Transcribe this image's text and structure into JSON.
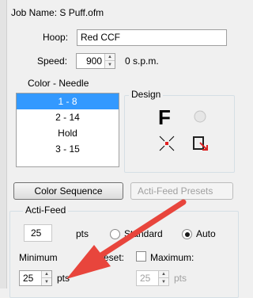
{
  "job_name": "Job Name: S Puff.ofm",
  "hoop": {
    "label": "Hoop:",
    "value": "Red CCF"
  },
  "speed": {
    "label": "Speed:",
    "value": "900",
    "display": "0 s.p.m."
  },
  "color_needle": {
    "label": "Color - Needle",
    "items": [
      "1 - 8",
      "2 - 14",
      "Hold",
      "3 - 15"
    ],
    "selected_index": 0
  },
  "design": {
    "label": "Design",
    "font_glyph": "F"
  },
  "buttons": {
    "color_sequence": "Color Sequence",
    "acti_feed_presets": "Acti-Feed Presets"
  },
  "acti_feed": {
    "label": "Acti-Feed",
    "value": "25",
    "value_unit": "pts",
    "standard_label": "Standard",
    "auto_label": "Auto",
    "selected_mode": "Auto",
    "minimum_label": "Minimum",
    "preset_label": "Preset:",
    "maximum_label": "Maximum:",
    "maximum_checked": false,
    "min_value": "25",
    "min_unit": "pts",
    "max_value": "25",
    "max_unit": "pts"
  },
  "colors": {
    "selection": "#3399ff",
    "arrow": "#e8453c"
  }
}
